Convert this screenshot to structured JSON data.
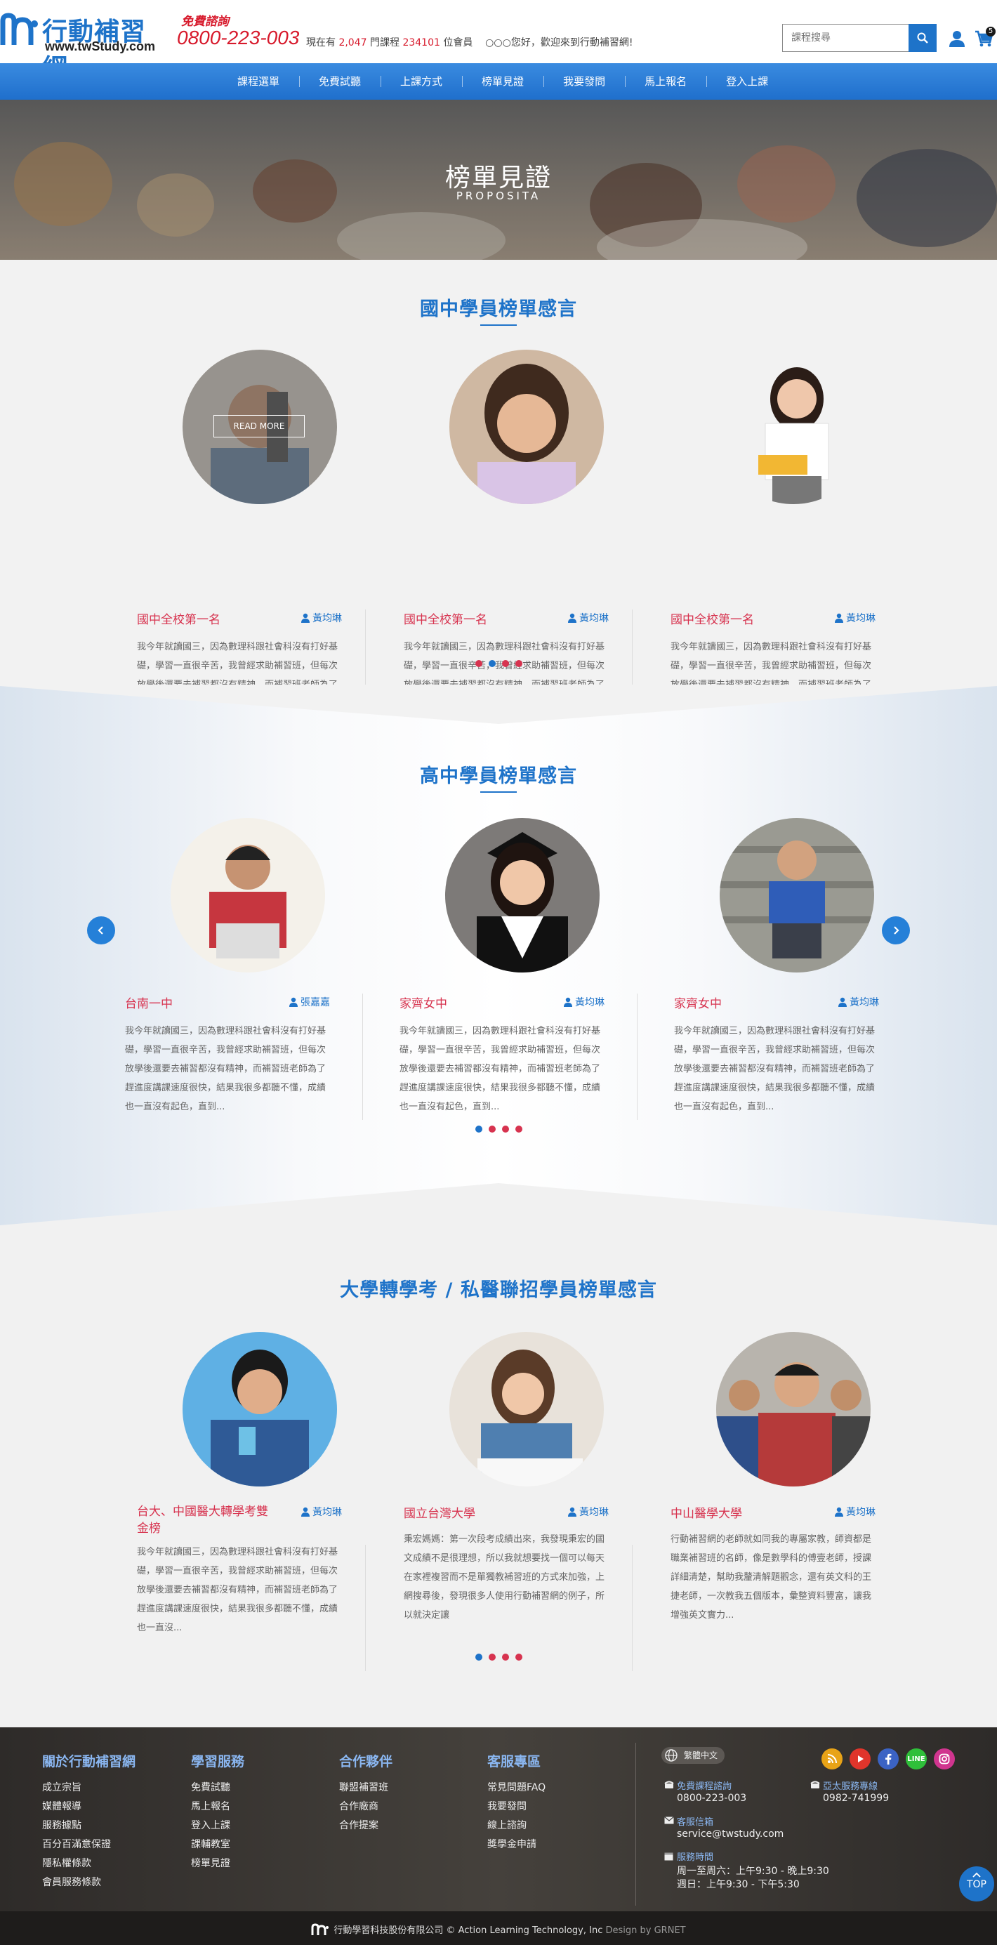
{
  "brand": {
    "name_cn": "行動補習網",
    "domain": "www.twStudy.com"
  },
  "hotline": {
    "label": "免費諮詢",
    "number": "0800-223-003"
  },
  "stats": {
    "prefix": "現在有",
    "courses": "2,047",
    "mid1": "門課程",
    "members": "234101",
    "mid2": "位會員",
    "greeting": "○○○您好，歡迎來到行動補習網!"
  },
  "search": {
    "placeholder": "課程搜尋"
  },
  "cart": {
    "count": "5"
  },
  "nav": {
    "items": [
      "課程選單",
      "免費試聽",
      "上課方式",
      "榜單見證",
      "我要發問",
      "馬上報名",
      "登入上課"
    ]
  },
  "hero": {
    "title": "榜單見證",
    "subtitle": "PROPOSITA"
  },
  "sections": [
    {
      "title": "國中學員榜單感言",
      "cards": [
        {
          "school": "國中全校第一名",
          "author": "黃均琳",
          "read_more": "READ MORE",
          "desc": "我今年就讀國三，因為數理科跟社會科沒有打好基礎，學習一直很辛苦，我曾經求助補習班，但每次放學後還要去補習都沒有精神，而補習班老師為了趕進度講課速度很快，結果我很多都聽不懂，成績也一直沒..."
        },
        {
          "school": "國中全校第一名",
          "author": "黃均琳",
          "desc": "我今年就讀國三，因為數理科跟社會科沒有打好基礎，學習一直很辛苦，我曾經求助補習班，但每次放學後還要去補習都沒有精神，而補習班老師為了趕進度講課速度很快，結果我很多都聽不懂，成績也一直沒..."
        },
        {
          "school": "國中全校第一名",
          "author": "黃均琳",
          "desc": "我今年就讀國三，因為數理科跟社會科沒有打好基礎，學習一直很辛苦，我曾經求助補習班，但每次放學後還要去補習都沒有精神，而補習班老師為了趕進度講課速度很快，結果我很多都聽不懂，成績也一直沒..."
        }
      ]
    },
    {
      "title": "高中學員榜單感言",
      "cards": [
        {
          "school": "台南一中",
          "author": "張嘉嘉",
          "desc": "我今年就讀國三，因為數理科跟社會科沒有打好基礎，學習一直很辛苦，我曾經求助補習班，但每次放學後還要去補習都沒有精神，而補習班老師為了趕進度講課速度很快，結果我很多都聽不懂，成績也一直沒有起色，直到..."
        },
        {
          "school": "家齊女中",
          "author": "黃均琳",
          "desc": "我今年就讀國三，因為數理科跟社會科沒有打好基礎，學習一直很辛苦，我曾經求助補習班，但每次放學後還要去補習都沒有精神，而補習班老師為了趕進度講課速度很快，結果我很多都聽不懂，成績也一直沒有起色，直到..."
        },
        {
          "school": "家齊女中",
          "author": "黃均琳",
          "desc": "我今年就讀國三，因為數理科跟社會科沒有打好基礎，學習一直很辛苦，我曾經求助補習班，但每次放學後還要去補習都沒有精神，而補習班老師為了趕進度講課速度很快，結果我很多都聽不懂，成績也一直沒有起色，直到..."
        }
      ]
    },
    {
      "title": "大學轉學考 / 私醫聯招學員榜單感言",
      "cards": [
        {
          "school": "台大、中國醫大轉學考雙金榜",
          "author": "黃均琳",
          "desc": "我今年就讀國三，因為數理科跟社會科沒有打好基礎，學習一直很辛苦，我曾經求助補習班，但每次放學後還要去補習都沒有精神，而補習班老師為了趕進度講課速度很快，結果我很多都聽不懂，成績也一直沒..."
        },
        {
          "school": "國立台灣大學",
          "author": "黃均琳",
          "desc": "秉宏媽媽：第一次段考成績出來，我發現秉宏的國文成績不是很理想，所以我就想要找一個可以每天在家裡複習而不是單獨教補習班的方式來加強，上網搜尋後，發現很多人使用行動補習網的例子，所以就決定讓"
        },
        {
          "school": "中山醫學大學",
          "author": "黃均琳",
          "desc": "行動補習網的老師就如同我的專屬家教，師資都是職業補習班的名師，像是數學科的傅壹老師，授課詳細清楚，幫助我釐清解題觀念，還有英文科的王捷老師，一次教我五個版本，彙整資料豐富，讓我增強英文實力..."
        }
      ]
    }
  ],
  "footer": {
    "columns": [
      {
        "title": "關於行動補習網",
        "links": [
          "成立宗旨",
          "媒體報導",
          "服務據點",
          "百分百滿意保證",
          "隱私權條款",
          "會員服務條款"
        ]
      },
      {
        "title": "學習服務",
        "links": [
          "免費試聽",
          "馬上報名",
          "登入上課",
          "課輔教室",
          "榜單見證"
        ]
      },
      {
        "title": "合作夥伴",
        "links": [
          "聯盟補習班",
          "合作廠商",
          "合作提案"
        ]
      },
      {
        "title": "客服專區",
        "links": [
          "常見問題FAQ",
          "我要發問",
          "線上諮詢",
          "獎學金申請"
        ]
      }
    ],
    "language": "繁體中文",
    "social": [
      "blog",
      "youtube",
      "facebook",
      "line",
      "instagram"
    ],
    "social_labels": [
      "LINE"
    ],
    "contact": {
      "free_label": "免費課程諮詢",
      "free_number": "0800-223-003",
      "apac_label": "亞太服務專線",
      "apac_number": "0982-741999",
      "mail_label": "客服信箱",
      "mail": "service@twstudy.com",
      "hours_label": "服務時間",
      "hours_1": "周一至周六：上午9:30 - 晚上9:30",
      "hours_2": "週日：上午9:30 - 下午5:30"
    },
    "top_label": "TOP",
    "copyright": "行動學習科技股份有限公司 © Action Learning Technology, Inc",
    "design_by": "Design by GRNET"
  },
  "colors": {
    "primary": "#1e73c9",
    "accent": "#d7334f",
    "footer_bg": "#2e2b29"
  }
}
